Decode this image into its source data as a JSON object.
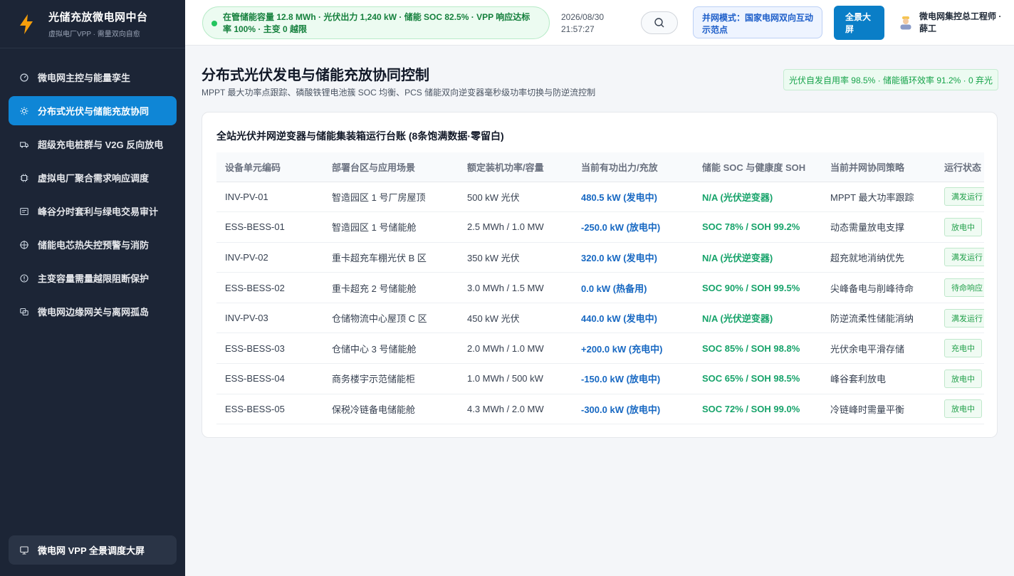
{
  "brand": {
    "title": "光储充放微电网中台",
    "subtitle": "虚拟电厂VPP · 需量双向自愈"
  },
  "sidebar": {
    "items": [
      {
        "label": "微电网主控与能量孪生",
        "icon": "gauge-icon"
      },
      {
        "label": "分布式光伏与储能充放协同",
        "icon": "sun-icon",
        "active": true
      },
      {
        "label": "超级充电桩群与 V2G 反向放电",
        "icon": "truck-icon"
      },
      {
        "label": "虚拟电厂聚合需求响应调度",
        "icon": "cpu-icon"
      },
      {
        "label": "峰谷分时套利与绿电交易审计",
        "icon": "ledger-icon"
      },
      {
        "label": "储能电芯热失控预警与消防",
        "icon": "target-icon"
      },
      {
        "label": "主变容量需量越限阻断保护",
        "icon": "info-icon"
      },
      {
        "label": "微电网边缘网关与离网孤岛",
        "icon": "gateway-icon"
      }
    ],
    "footer_label": "微电网 VPP 全景调度大屏"
  },
  "header": {
    "status_text": "在管储能容量 12.8 MWh · 光伏出力 1,240 kW · 储能 SOC 82.5% · VPP 响应达标率 100% · 主变 0 越限",
    "date": "2026/08/30",
    "time": "21:57:27",
    "mode_text": "并网模式：国家电网双向互动示范点",
    "fullscreen_label": "全景大屏",
    "user_name": "微电网集控总工程师 · 薛工"
  },
  "page": {
    "title": "分布式光伏发电与储能充放协同控制",
    "subtitle": "MPPT 最大功率点跟踪、磷酸铁锂电池簇 SOC 均衡、PCS 储能双向逆变器毫秒级功率切换与防逆流控制",
    "kpi": "光伏自发自用率 98.5% · 储能循环效率 91.2% · 0 弃光"
  },
  "table": {
    "title": "全站光伏并网逆变器与储能集装箱运行台账 (8条饱满数据·零留白)",
    "headers": [
      "设备单元编码",
      "部署台区与应用场景",
      "额定装机功率/容量",
      "当前有功出力/充放",
      "储能 SOC 与健康度 SOH",
      "当前并网协同策略",
      "运行状态"
    ],
    "rows": [
      {
        "code": "INV-PV-01",
        "site": "智造园区 1 号厂房屋顶",
        "rated": "500 kW 光伏",
        "power": "480.5 kW (发电中)",
        "soc": "N/A (光伏逆变器)",
        "strategy": "MPPT 最大功率跟踪",
        "state": "满发运行"
      },
      {
        "code": "ESS-BESS-01",
        "site": "智造园区 1 号储能舱",
        "rated": "2.5 MWh / 1.0 MW",
        "power": "-250.0 kW (放电中)",
        "soc": "SOC 78% / SOH 99.2%",
        "strategy": "动态需量放电支撑",
        "state": "放电中"
      },
      {
        "code": "INV-PV-02",
        "site": "重卡超充车棚光伏 B 区",
        "rated": "350 kW 光伏",
        "power": "320.0 kW (发电中)",
        "soc": "N/A (光伏逆变器)",
        "strategy": "超充就地消纳优先",
        "state": "满发运行"
      },
      {
        "code": "ESS-BESS-02",
        "site": "重卡超充 2 号储能舱",
        "rated": "3.0 MWh / 1.5 MW",
        "power": "0.0 kW (热备用)",
        "soc": "SOC 90% / SOH 99.5%",
        "strategy": "尖峰备电与削峰待命",
        "state": "待命响应"
      },
      {
        "code": "INV-PV-03",
        "site": "仓储物流中心屋顶 C 区",
        "rated": "450 kW 光伏",
        "power": "440.0 kW (发电中)",
        "soc": "N/A (光伏逆变器)",
        "strategy": "防逆流柔性储能消纳",
        "state": "满发运行"
      },
      {
        "code": "ESS-BESS-03",
        "site": "仓储中心 3 号储能舱",
        "rated": "2.0 MWh / 1.0 MW",
        "power": "+200.0 kW (充电中)",
        "soc": "SOC 85% / SOH 98.8%",
        "strategy": "光伏余电平滑存储",
        "state": "充电中"
      },
      {
        "code": "ESS-BESS-04",
        "site": "商务楼宇示范储能柜",
        "rated": "1.0 MWh / 500 kW",
        "power": "-150.0 kW (放电中)",
        "soc": "SOC 65% / SOH 98.5%",
        "strategy": "峰谷套利放电",
        "state": "放电中"
      },
      {
        "code": "ESS-BESS-05",
        "site": "保税冷链备电储能舱",
        "rated": "4.3 MWh / 2.0 MW",
        "power": "-300.0 kW (放电中)",
        "soc": "SOC 72% / SOH 99.0%",
        "strategy": "冷链峰时需量平衡",
        "state": "放电中"
      }
    ]
  },
  "colors": {
    "accent": "#0f86d6",
    "sidebar_bg": "#1c2536",
    "success": "#16a34a",
    "power_blue": "#1768c2"
  }
}
